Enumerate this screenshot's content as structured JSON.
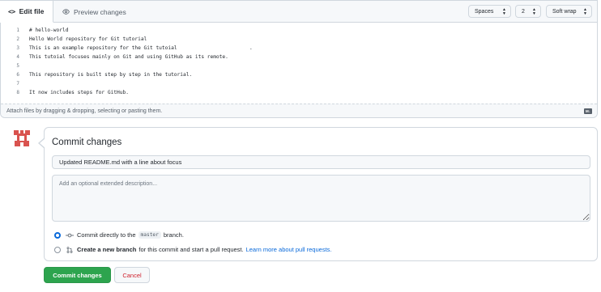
{
  "editor": {
    "tabs": {
      "edit": "Edit file",
      "preview": "Preview changes"
    },
    "indent_mode": "Spaces",
    "indent_size": "2",
    "wrap_mode": "Soft wrap",
    "lines": [
      {
        "num": "1",
        "text": "# hello-world"
      },
      {
        "num": "2",
        "text": "Hello World repository for Git tutorial"
      },
      {
        "num": "3",
        "text": "This is an example repository for the Git tutoial                        ."
      },
      {
        "num": "4",
        "text": "This tutoial focuses mainly on Git and using GitHub as its remote."
      },
      {
        "num": "5",
        "text": ""
      },
      {
        "num": "6",
        "text": "This repository is built step by step in the tutorial."
      },
      {
        "num": "7",
        "text": ""
      },
      {
        "num": "8",
        "text": "It now includes steps for GitHub."
      }
    ],
    "attach_hint": "Attach files by dragging & dropping, selecting or pasting them.",
    "markdown_badge": "M↓"
  },
  "commit": {
    "title": "Commit changes",
    "summary_value": "Updated README.md with a line about focus",
    "description_placeholder": "Add an optional extended description...",
    "option_direct": {
      "prefix": "Commit directly to the",
      "branch": "master",
      "suffix": "branch."
    },
    "option_new": {
      "bold": "Create a new branch",
      "text": "for this commit and start a pull request.",
      "link": "Learn more about pull requests."
    },
    "commit_button": "Commit changes",
    "cancel_button": "Cancel"
  },
  "colors": {
    "accent": "#0969da",
    "commit_button": "#2da44e",
    "cancel_text": "#cf222e",
    "avatar": "#d9534f"
  }
}
